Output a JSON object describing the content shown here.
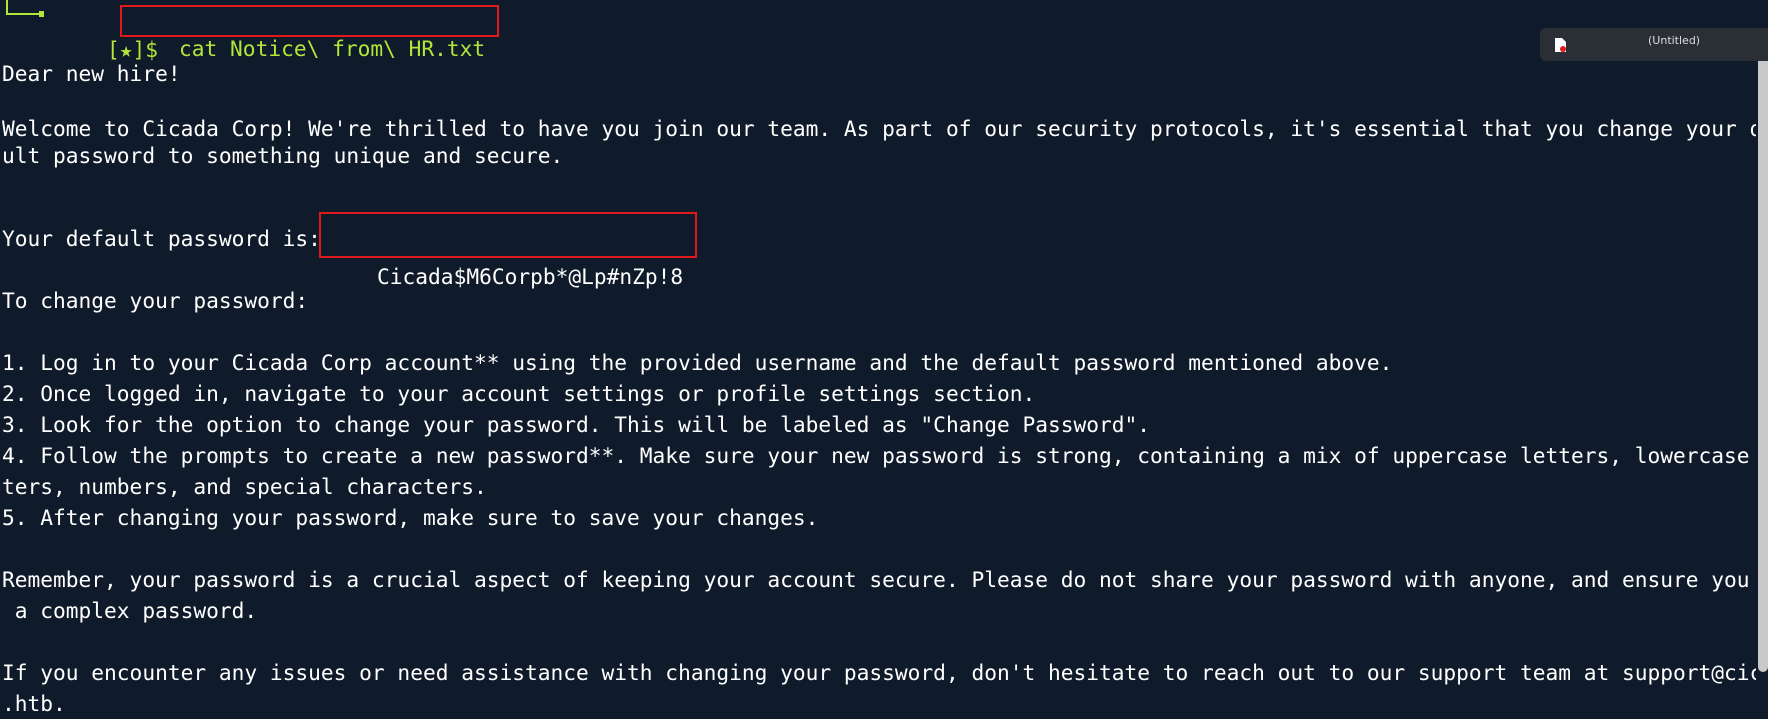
{
  "prompt": {
    "symbol": "[★]$",
    "command": "cat Notice\\ from\\ HR.txt"
  },
  "floating_window": {
    "title": "(Untitled)"
  },
  "notice": {
    "greeting": "Dear new hire!",
    "welcome_1": "Welcome to Cicada Corp! We're thrilled to have you join our team. As part of our security protocols, it's essential that you change your defa",
    "welcome_2": "ult password to something unique and secure.",
    "password_label": "Your default password is: ",
    "password_value": "Cicada$M6Corpb*@Lp#nZp!8",
    "change_heading": "To change your password:",
    "step_1": "1. Log in to your Cicada Corp account** using the provided username and the default password mentioned above.",
    "step_2": "2. Once logged in, navigate to your account settings or profile settings section.",
    "step_3": "3. Look for the option to change your password. This will be labeled as \"Change Password\".",
    "step_4a": "4. Follow the prompts to create a new password**. Make sure your new password is strong, containing a mix of uppercase letters, lowercase let",
    "step_4b": "ters, numbers, and special characters.",
    "step_5": "5. After changing your password, make sure to save your changes.",
    "remember_1": "Remember, your password is a crucial aspect of keeping your account secure. Please do not share your password with anyone, and ensure you use",
    "remember_2": " a complex password.",
    "support_1": "If you encounter any issues or need assistance with changing your password, don't hesitate to reach out to our support team at support@cicada",
    "support_2": ".htb."
  },
  "colors": {
    "background": "#0f1b2a",
    "prompt": "#b3e53a",
    "highlight_border": "#e01a1a",
    "text": "#ffffff"
  }
}
